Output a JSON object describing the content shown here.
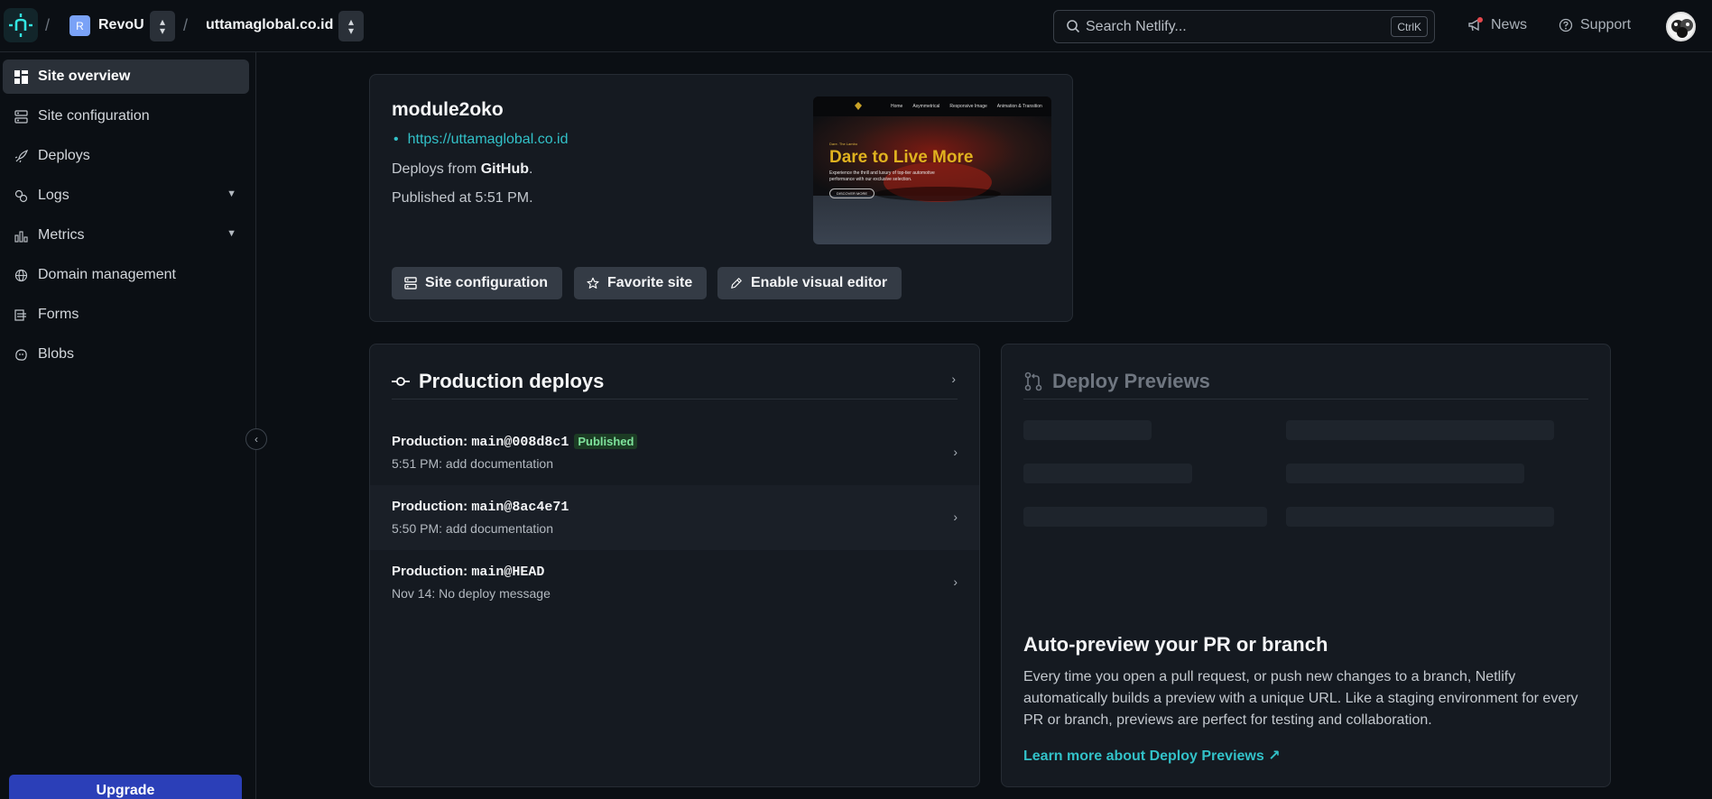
{
  "topbar": {
    "team_initial": "R",
    "team_name": "RevoU",
    "site_domain": "uttamaglobal.co.id",
    "search_placeholder": "Search Netlify...",
    "search_shortcut": "CtrlK",
    "news_label": "News",
    "support_label": "Support"
  },
  "sidebar": {
    "items": [
      {
        "label": "Site overview"
      },
      {
        "label": "Site configuration"
      },
      {
        "label": "Deploys"
      },
      {
        "label": "Logs"
      },
      {
        "label": "Metrics"
      },
      {
        "label": "Domain management"
      },
      {
        "label": "Forms"
      },
      {
        "label": "Blobs"
      }
    ],
    "upgrade_label": "Upgrade"
  },
  "site": {
    "name": "module2oko",
    "url": "https://uttamaglobal.co.id",
    "deploys_from_prefix": "Deploys from",
    "deploys_from_source": "GitHub",
    "deploys_from_suffix": ".",
    "published": "Published at 5:51 PM.",
    "thumbnail": {
      "nav": [
        "Home",
        "Asymmetrical",
        "Responsive Image",
        "Animation & Transition"
      ],
      "kicker": "Dare. The Lambo",
      "headline": "Dare to Live More",
      "tagline": "Experience the thrill and luxury of top-tier automotive performance with our exclusive selection.",
      "cta": "DISCOVER MORE"
    },
    "buttons": {
      "site_configuration": "Site configuration",
      "favorite_site": "Favorite site",
      "enable_visual_editor": "Enable visual editor"
    }
  },
  "production_deploys": {
    "title": "Production deploys",
    "rows": [
      {
        "prefix": "Production:",
        "ref": "main@008d8c1",
        "badge": "Published",
        "detail": "5:51 PM: add documentation"
      },
      {
        "prefix": "Production:",
        "ref": "main@8ac4e71",
        "detail": "5:50 PM: add documentation"
      },
      {
        "prefix": "Production:",
        "ref": "main@HEAD",
        "detail": "Nov 14: No deploy message"
      }
    ]
  },
  "deploy_previews": {
    "title": "Deploy Previews",
    "heading": "Auto-preview your PR or branch",
    "body": "Every time you open a pull request, or push new changes to a branch, Netlify automatically builds a preview with a unique URL. Like a staging environment for every PR or branch, previews are perfect for testing and collaboration.",
    "link": "Learn more about Deploy Previews ↗"
  },
  "colors": {
    "accent_teal": "#32c1c8",
    "upgrade_blue": "#2b3fb8",
    "published_green": "#7ee29b",
    "notification_red": "#e5484d"
  }
}
